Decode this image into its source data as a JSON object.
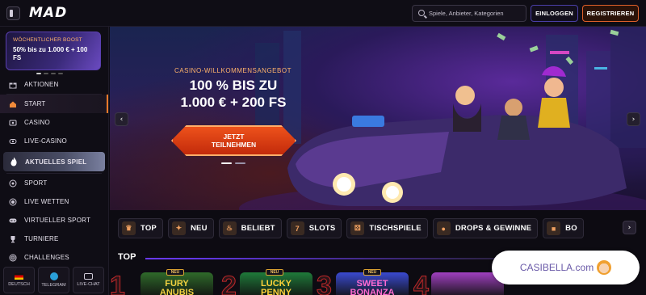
{
  "header": {
    "logo": "MAD",
    "search_placeholder": "Spiele, Anbieter, Kategorien",
    "login_label": "EINLOGGEN",
    "register_label": "REGISTRIEREN"
  },
  "sidebar": {
    "promo": {
      "title": "WÖCHENTLICHER BOOST",
      "text": "50% bis zu 1.000 € + 100 FS"
    },
    "items": [
      {
        "label": "AKTIONEN",
        "icon": "gift-icon"
      },
      {
        "label": "START",
        "icon": "home-icon"
      },
      {
        "label": "CASINO",
        "icon": "cards-icon"
      },
      {
        "label": "LIVE-CASINO",
        "icon": "live-icon"
      },
      {
        "label": "AKTUELLES SPIEL",
        "icon": "fire-icon"
      },
      {
        "label": "SPORT",
        "icon": "ball-icon"
      },
      {
        "label": "LIVE WETTEN",
        "icon": "live-dot-icon"
      },
      {
        "label": "VIRTUELLER SPORT",
        "icon": "gamepad-icon"
      },
      {
        "label": "TURNIERE",
        "icon": "trophy-icon"
      },
      {
        "label": "CHALLENGES",
        "icon": "target-icon"
      }
    ],
    "bottom": [
      {
        "label": "DEUTSCH",
        "icon": "flag-de-icon"
      },
      {
        "label": "TELEGRAM",
        "icon": "telegram-icon"
      },
      {
        "label": "LIVE-CHAT",
        "icon": "chat-icon"
      }
    ]
  },
  "hero": {
    "kicker": "CASINO-WILLKOMMENSANGEBOT",
    "title_line1": "100 % BIS ZU",
    "title_line2": "1.000 € + 200 FS",
    "cta_line1": "JETZT",
    "cta_line2": "TEILNEHMEN"
  },
  "categories": [
    {
      "label": "TOP",
      "icon": "crown-icon"
    },
    {
      "label": "NEU",
      "icon": "spark-icon"
    },
    {
      "label": "BELIEBT",
      "icon": "flame-icon"
    },
    {
      "label": "SLOTS",
      "icon": "slot-icon"
    },
    {
      "label": "TISCHSPIELE",
      "icon": "dice-icon"
    },
    {
      "label": "DROPS & GEWINNE",
      "icon": "coin-icon"
    },
    {
      "label": "BO",
      "icon": "box-icon"
    }
  ],
  "top_section": {
    "title": "TOP",
    "new_badge": "NEU",
    "games": [
      {
        "rank": "1",
        "name_line1": "FURY",
        "name_line2": "ANUBIS",
        "color": "#2f6a2a"
      },
      {
        "rank": "2",
        "name_line1": "LUCKY",
        "name_line2": "PENNY",
        "color": "#1f7a3a"
      },
      {
        "rank": "3",
        "name_line1": "SWEET",
        "name_line2": "BONANZA",
        "color": "#3a4ad0"
      },
      {
        "rank": "4",
        "name_line1": "",
        "name_line2": "",
        "color": "#a040c0"
      }
    ]
  },
  "watermark": {
    "text": "CASIBELLA.com"
  }
}
